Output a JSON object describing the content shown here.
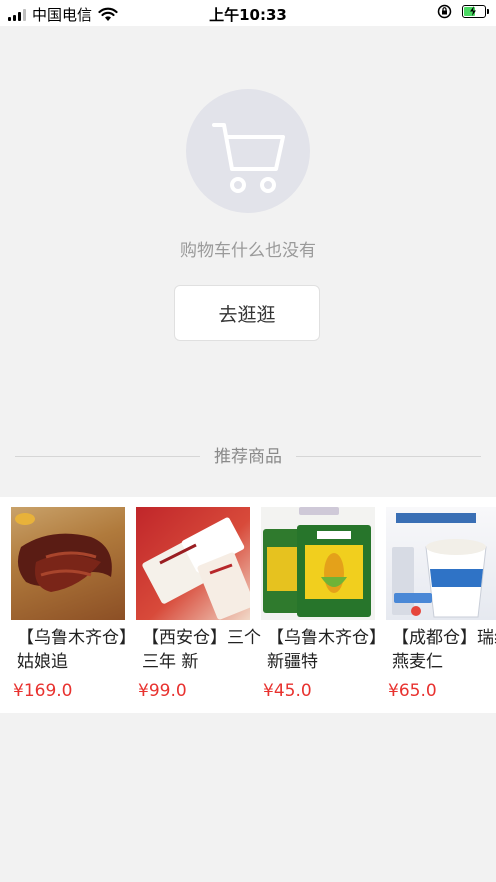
{
  "status_bar": {
    "carrier": "中国电信",
    "time": "上午10:33",
    "battery_level": 0.6,
    "signal_bars": 2
  },
  "empty_cart": {
    "icon": "cart-icon",
    "message": "购物车什么也没有",
    "button_label": "去逛逛"
  },
  "recommended": {
    "title": "推荐商品",
    "products": [
      {
        "name": "【乌鲁木齐仓】姑娘追",
        "price": "¥169.0",
        "image": "dried-beef-image"
      },
      {
        "name": "【西安仓】三个三年 新",
        "price": "¥99.0",
        "image": "milk-tea-box-image"
      },
      {
        "name": "【乌鲁木齐仓】新疆特",
        "price": "¥45.0",
        "image": "corn-powder-bag-image"
      },
      {
        "name": "【成都仓】瑞缘燕麦仁",
        "price": "¥65.0",
        "image": "oat-yogurt-cup-image"
      }
    ]
  },
  "colors": {
    "background": "#f2f2f2",
    "price": "#e8322f",
    "cart_circle": "#e2e3ea"
  }
}
